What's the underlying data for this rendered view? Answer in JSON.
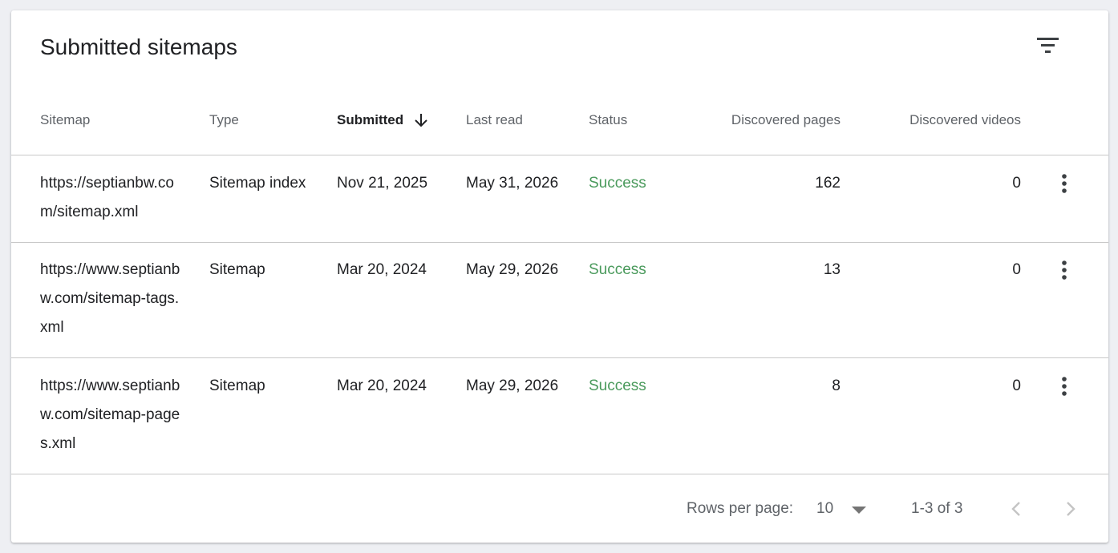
{
  "card": {
    "title": "Submitted sitemaps",
    "filter_icon": "filter-icon"
  },
  "table": {
    "columns": {
      "sitemap": "Sitemap",
      "type": "Type",
      "submitted": "Submitted",
      "last_read": "Last read",
      "status": "Status",
      "discovered_pages": "Discovered pages",
      "discovered_videos": "Discovered videos"
    },
    "sort": {
      "column": "Submitted",
      "direction": "descending",
      "icon": "arrow-down-icon"
    },
    "rows": [
      {
        "sitemap": "https://septianbw.com/sitemap.xml",
        "type": "Sitemap index",
        "submitted": "Nov 21, 2025",
        "last_read": "May 31, 2026",
        "status": "Success",
        "discovered_pages": "162",
        "discovered_videos": "0"
      },
      {
        "sitemap": "https://www.septianbw.com/sitemap-tags.xml",
        "type": "Sitemap",
        "submitted": "Mar 20, 2024",
        "last_read": "May 29, 2026",
        "status": "Success",
        "discovered_pages": "13",
        "discovered_videos": "0"
      },
      {
        "sitemap": "https://www.septianbw.com/sitemap-pages.xml",
        "type": "Sitemap",
        "submitted": "Mar 20, 2024",
        "last_read": "May 29, 2026",
        "status": "Success",
        "discovered_pages": "8",
        "discovered_videos": "0"
      }
    ]
  },
  "pagination": {
    "rows_per_page_label": "Rows per page:",
    "rows_per_page_value": "10",
    "range_text": "1-3 of 3",
    "prev_icon": "chevron-left-icon",
    "next_icon": "chevron-right-icon"
  },
  "colors": {
    "status_success": "#4a9a5c",
    "background": "#eeeff3"
  }
}
